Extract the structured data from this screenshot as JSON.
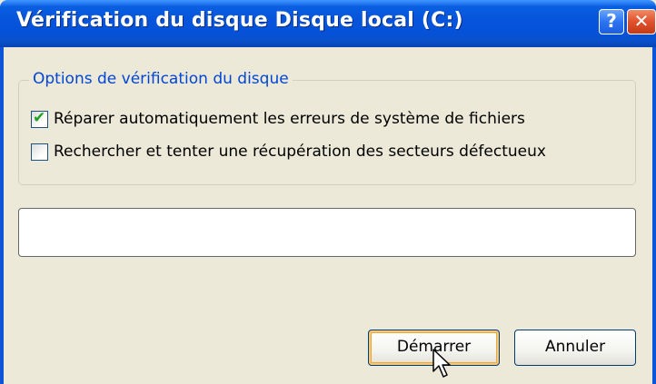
{
  "window": {
    "title": "Vérification du disque Disque local (C:)",
    "help_label": "?",
    "close_label": "✕"
  },
  "group": {
    "legend": "Options de vérification du disque",
    "options": [
      {
        "label": "Réparer automatiquement les erreurs de système de fichiers",
        "checked": true
      },
      {
        "label": "Rechercher et tenter une récupération des secteurs défectueux",
        "checked": false
      }
    ]
  },
  "progress": {
    "value_percent": 0
  },
  "buttons": {
    "start_label": "Démarrer",
    "cancel_label": "Annuler"
  },
  "colors": {
    "titlebar": "#0655dc",
    "legend_text": "#0046d5",
    "checkmark": "#21a121",
    "dialog_bg": "#ece9d8"
  },
  "icons": {
    "checkmark": "check-icon",
    "cursor": "mouse-pointer-icon"
  }
}
